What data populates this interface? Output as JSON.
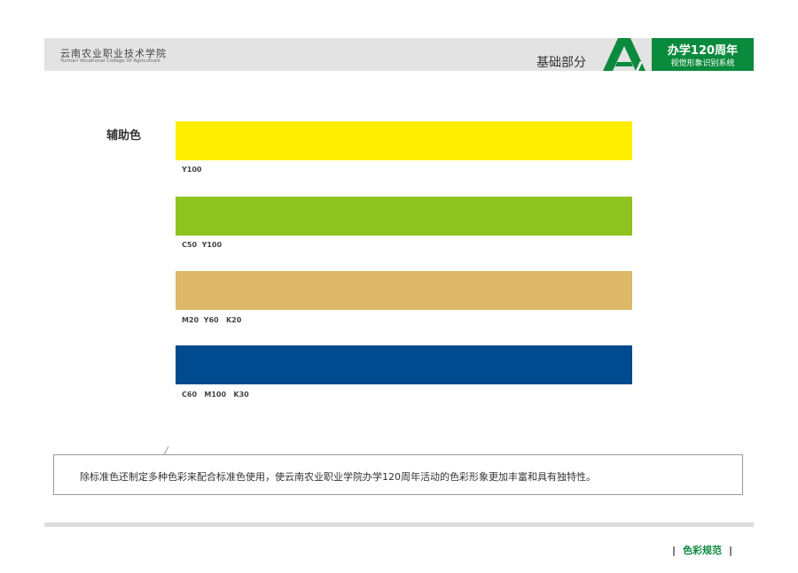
{
  "header": {
    "school_cn": "云南农业职业技术学院",
    "school_en": "Yunnan Vocational College Of Agriculture",
    "section_title": "基础部分",
    "badge_line1": "办学120周年",
    "badge_line2": "视觉形象识别系统"
  },
  "content": {
    "label": "辅助色",
    "swatches": [
      {
        "color": "#ffee00",
        "caption": "Y100"
      },
      {
        "color": "#8fc31f",
        "caption": "C50  Y100"
      },
      {
        "color": "#dcb868",
        "caption": "M20  Y60   K20"
      },
      {
        "color": "#004a8f",
        "caption": "C60   M100   K30"
      }
    ]
  },
  "description": "除标准色还制定多种色彩来配合标准色使用，使云南农业职业学院办学120周年活动的色彩形象更加丰富和具有独特性。",
  "footer": {
    "label": "色彩规范",
    "separator": "|"
  },
  "colors": {
    "brand_green": "#0a8a3d",
    "header_gray": "#e3e3e3"
  }
}
